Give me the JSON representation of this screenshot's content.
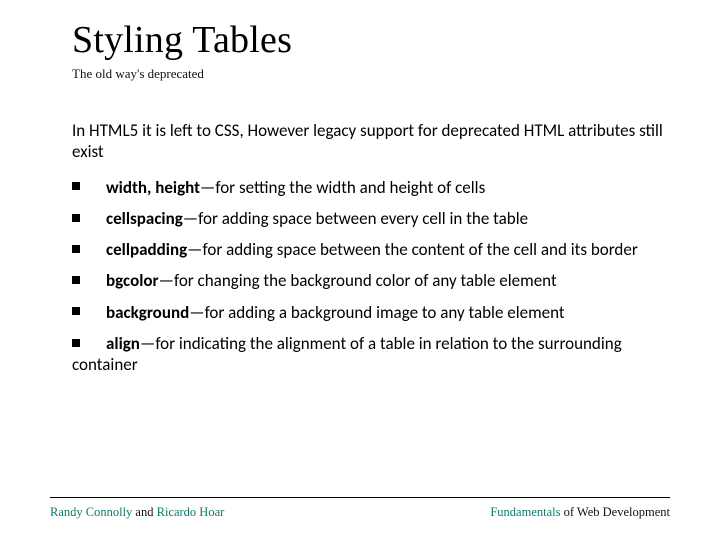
{
  "title": "Styling Tables",
  "subtitle": "The old way's deprecated",
  "intro": "In HTML5 it is left to CSS, However legacy support for deprecated HTML attributes still exist",
  "items": [
    {
      "bold": "width, height",
      "rest": "—for setting the width and height of cells"
    },
    {
      "bold": "cellspacing",
      "rest": "—for adding space between every cell in the table"
    },
    {
      "bold": "cellpadding",
      "rest": "—for adding space between the content of the cell and its border"
    },
    {
      "bold": "bgcolor",
      "rest": "—for changing the background color of any table element"
    },
    {
      "bold": "background",
      "rest": "—for adding a background image to any table element"
    },
    {
      "bold": "align",
      "rest": "—for indicating the alignment of a table in relation to the surrounding container"
    }
  ],
  "footer": {
    "left_author1": "Randy Connolly",
    "left_and": " and ",
    "left_author2": "Ricardo Hoar",
    "right_word1": "Fundamentals",
    "right_rest": " of Web Development"
  }
}
